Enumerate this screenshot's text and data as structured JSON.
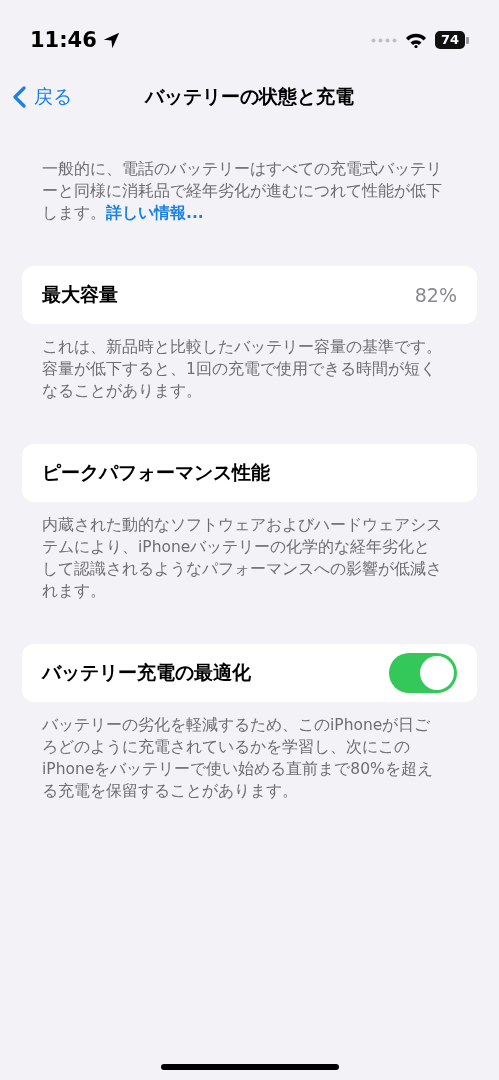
{
  "status_bar": {
    "time": "11:46",
    "battery": "74"
  },
  "nav": {
    "back": "戻る",
    "title": "バッテリーの状態と充電"
  },
  "intro": {
    "text": "一般的に、電話のバッテリーはすべての充電式バッテリーと同様に消耗品で経年劣化が進むにつれて性能が低下します。",
    "link": "詳しい情報..."
  },
  "sections": [
    {
      "kind": "value",
      "label": "最大容量",
      "value": "82%",
      "caption": "これは、新品時と比較したバッテリー容量の基準です。容量が低下すると、1回の充電で使用できる時間が短くなることがあります。"
    },
    {
      "kind": "plain",
      "label": "ピークパフォーマンス性能",
      "caption": "内蔵された動的なソフトウェアおよびハードウェアシステムにより、iPhoneバッテリーの化学的な経年劣化として認識されるようなパフォーマンスへの影響が低減されます。"
    },
    {
      "kind": "toggle",
      "label": "バッテリー充電の最適化",
      "on": true,
      "caption": "バッテリーの劣化を軽減するため、このiPhoneが日ごろどのように充電されているかを学習し、次にこのiPhoneをバッテリーで使い始める直前まで80%を超える充電を保留することがあります。"
    }
  ]
}
